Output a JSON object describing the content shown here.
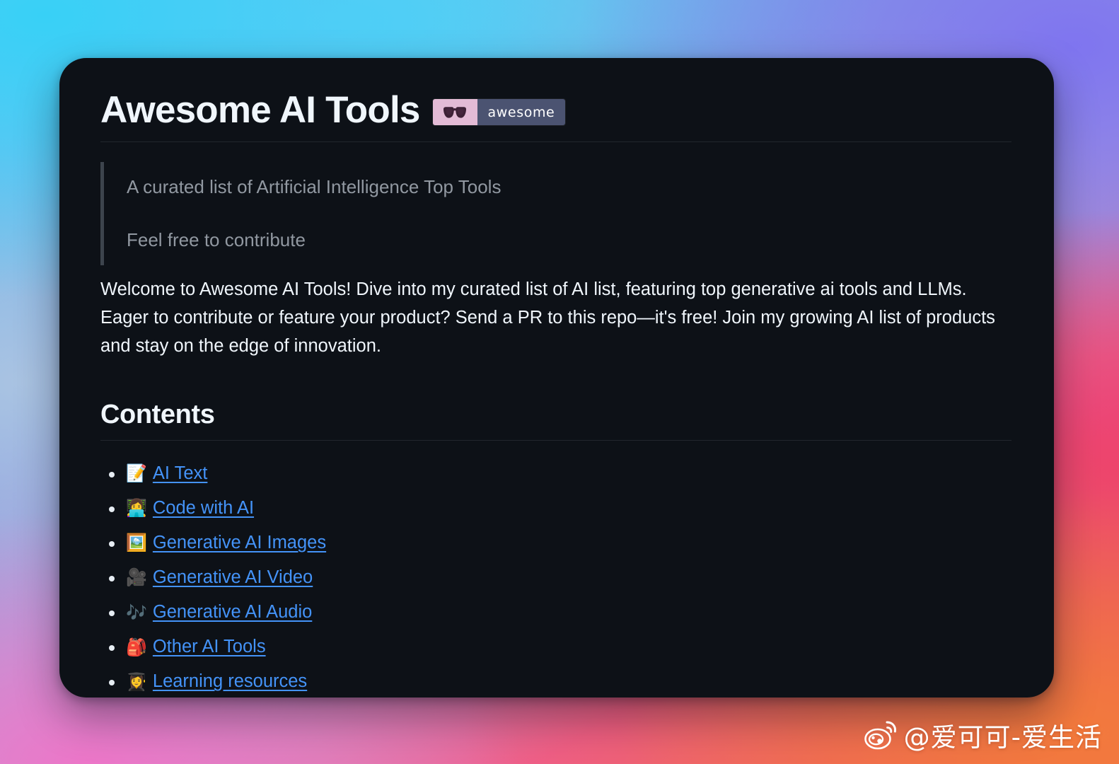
{
  "header": {
    "title": "Awesome AI Tools",
    "badge": {
      "label": "awesome",
      "icon": "sunglasses-icon",
      "left_color": "#e3bbd6",
      "right_color": "#4b5371"
    }
  },
  "blockquote": {
    "lines": [
      "A curated list of Artificial Intelligence Top Tools",
      "Feel free to contribute"
    ]
  },
  "intro": {
    "text": "Welcome to Awesome AI Tools! Dive into my curated list of AI list, featuring top generative ai tools and LLMs. Eager to contribute or feature your product? Send a PR to this repo—it's free! Join my growing AI list of products and stay on the edge of innovation."
  },
  "contents": {
    "heading": "Contents",
    "items": [
      {
        "emoji": "📝",
        "icon_name": "memo-icon",
        "label": "AI Text"
      },
      {
        "emoji": "👩‍💻",
        "icon_name": "woman-technologist-icon",
        "label": "Code with AI"
      },
      {
        "emoji": "🖼️",
        "icon_name": "framed-picture-icon",
        "label": "Generative AI Images"
      },
      {
        "emoji": "🎥",
        "icon_name": "movie-camera-icon",
        "label": "Generative AI Video"
      },
      {
        "emoji": "🎶",
        "icon_name": "musical-notes-icon",
        "label": "Generative AI Audio"
      },
      {
        "emoji": "🎒",
        "icon_name": "backpack-icon",
        "label": "Other AI Tools"
      },
      {
        "emoji": "👩‍🎓",
        "icon_name": "woman-student-icon",
        "label": "Learning resources"
      }
    ]
  },
  "watermark": {
    "handle": "@爱可可-爱生活",
    "icon": "weibo-logo-icon"
  },
  "colors": {
    "card_background": "#0d1117",
    "text_primary": "#f0f6fc",
    "text_muted": "#9198a1",
    "link": "#4493f8",
    "rule": "#21262d",
    "quote_border": "#3d444d"
  }
}
